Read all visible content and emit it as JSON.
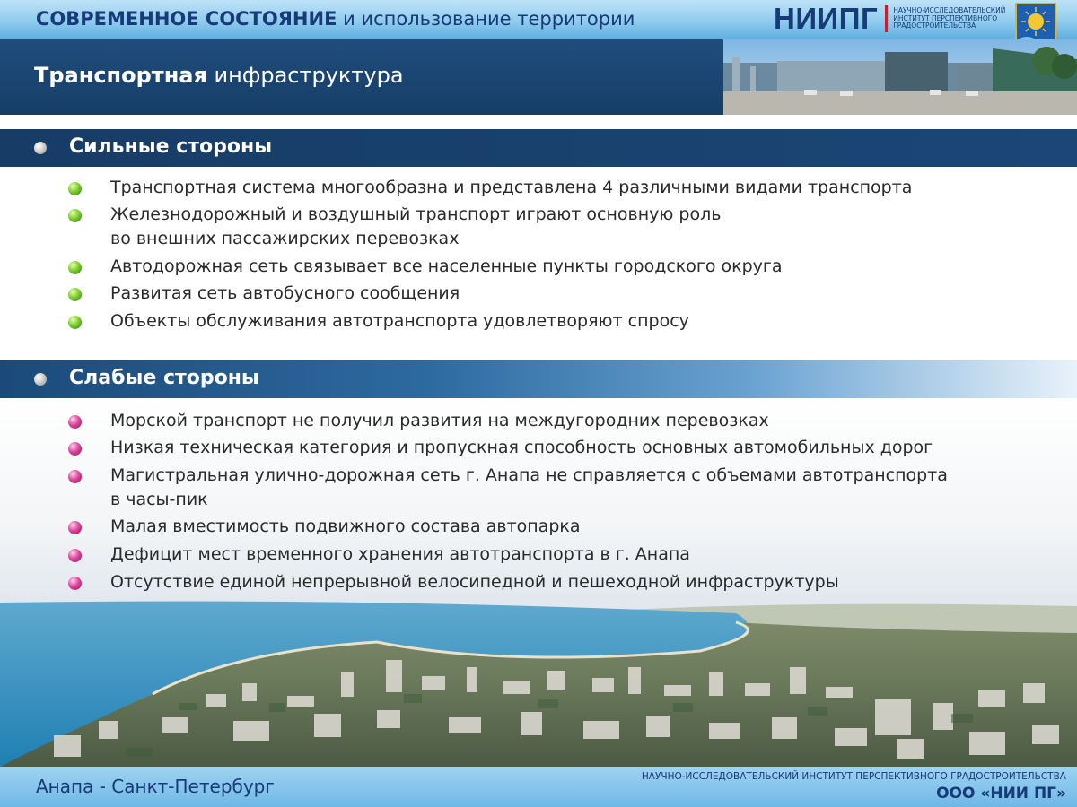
{
  "topbar": {
    "title_bold": "СОВРЕМЕННОЕ СОСТОЯНИЕ",
    "title_rest": " и использование территории",
    "logo_big": "НИИПГ",
    "logo_small": "НАУЧНО-ИССЛЕДОВАТЕЛЬСКИЙ ИНСТИТУТ ПЕРСПЕКТИВНОГО ГРАДОСТРОИТЕЛЬСТВА"
  },
  "header": {
    "title_bold": "Транспортная",
    "title_rest": " инфраструктура"
  },
  "strong": {
    "title": "Сильные стороны",
    "items": [
      {
        "lines": [
          "Транспортная система многообразна и представлена 4 различными видами транспорта"
        ]
      },
      {
        "lines": [
          "Железнодорожный и воздушный транспорт играют основную роль",
          "во внешних пассажирских перевозках"
        ]
      },
      {
        "lines": [
          "Автодорожная сеть связывает все населенные пункты городского округа"
        ]
      },
      {
        "lines": [
          "Развитая сеть автобусного сообщения"
        ]
      },
      {
        "lines": [
          "Объекты обслуживания автотранспорта удовлетворяют спросу"
        ]
      }
    ]
  },
  "weak": {
    "title": "Слабые стороны",
    "items": [
      {
        "lines": [
          "Морской транспорт не получил развития на междугородних перевозках"
        ]
      },
      {
        "lines": [
          "Низкая техническая категория и пропускная способность основных автомобильных дорог"
        ]
      },
      {
        "lines": [
          "Магистральная улично-дорожная сеть г. Анапа не справляется с объемами автотранспорта",
          "в часы-пик"
        ]
      },
      {
        "lines": [
          "Малая вместимость подвижного состава автопарка"
        ]
      },
      {
        "lines": [
          "Дефицит мест временного хранения автотранспорта в г. Анапа"
        ]
      },
      {
        "lines": [
          "Отсутствие единой непрерывной велосипедной и пешеходной инфраструктуры"
        ]
      }
    ]
  },
  "footer": {
    "left": "Анапа - Санкт-Петербург",
    "right_line1": "НАУЧНО-ИССЛЕДОВАТЕЛЬСКИЙ ИНСТИТУТ ПЕРСПЕКТИВНОГО ГРАДОСТРОИТЕЛЬСТВА",
    "right_line2": "ООО «НИИ ПГ»"
  },
  "colors": {
    "navy": "#173a78",
    "band_dark": "#173c66",
    "bullet_green": "#7dcf2e",
    "bullet_pink": "#e0489e"
  }
}
